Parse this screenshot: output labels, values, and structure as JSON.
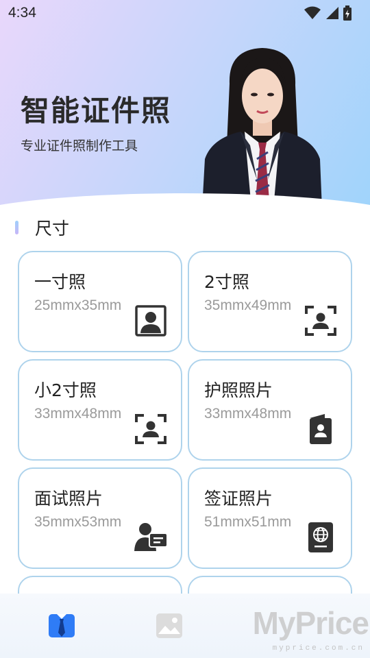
{
  "status_bar": {
    "time": "4:34"
  },
  "hero": {
    "title": "智能证件照",
    "subtitle": "专业证件照制作工具"
  },
  "section": {
    "label": "尺寸"
  },
  "cards": [
    {
      "name": "一寸照",
      "size": "25mmx35mm",
      "icon": "portrait-frame-icon"
    },
    {
      "name": "2寸照",
      "size": "35mmx49mm",
      "icon": "face-scan-icon"
    },
    {
      "name": "小2寸照",
      "size": "33mmx48mm",
      "icon": "face-scan-icon"
    },
    {
      "name": "护照照片",
      "size": "33mmx48mm",
      "icon": "passport-photo-icon"
    },
    {
      "name": "面试照片",
      "size": "35mmx53mm",
      "icon": "interview-chat-icon"
    },
    {
      "name": "签证照片",
      "size": "51mmx51mm",
      "icon": "passport-globe-icon"
    }
  ],
  "bottom_nav": {
    "items": [
      {
        "icon": "suit-tie-icon",
        "active": true
      },
      {
        "icon": "gallery-image-icon",
        "active": false
      }
    ]
  },
  "watermark": {
    "brand": "MyPrice",
    "domain": "myprice.com.cn"
  },
  "colors": {
    "accent": "#2f7cf6",
    "card_border": "#aed3ec",
    "secondary_text": "#9a9a9a",
    "hero_gradient": [
      "#e9d7fb",
      "#c8d6fb",
      "#9fd4fb"
    ]
  }
}
